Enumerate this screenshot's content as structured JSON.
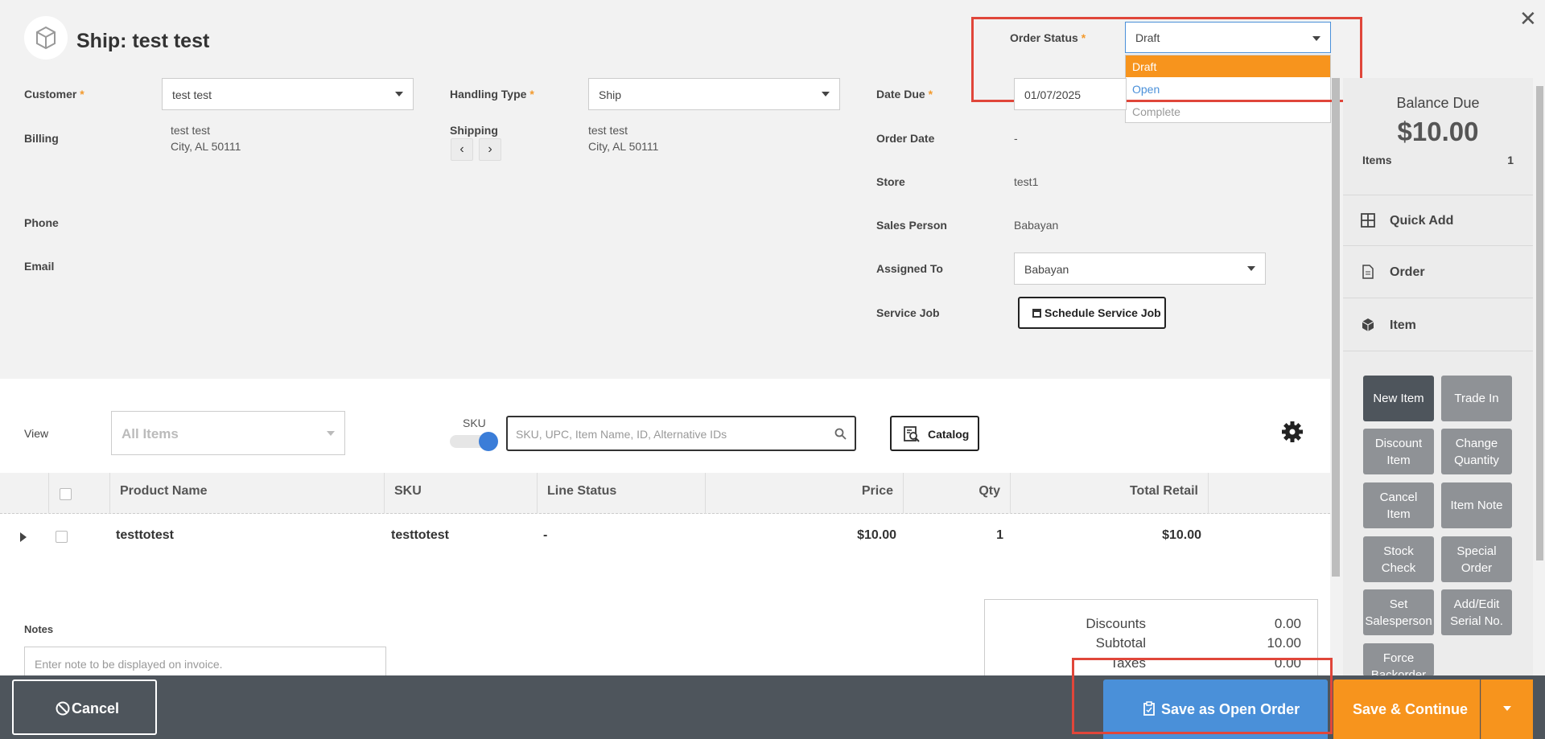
{
  "header": {
    "title": "Ship: test test",
    "close_label": "✕"
  },
  "order_status": {
    "label": "Order Status",
    "required": "*",
    "value": "Draft",
    "options": [
      "Draft",
      "Open",
      "Complete"
    ]
  },
  "customer": {
    "label": "Customer",
    "required": "*",
    "value": "test test"
  },
  "billing": {
    "label": "Billing",
    "line1": "test test",
    "line2": "City, AL 50111"
  },
  "phone": {
    "label": "Phone"
  },
  "email": {
    "label": "Email"
  },
  "handling": {
    "label": "Handling Type",
    "required": "*",
    "value": "Ship"
  },
  "shipping": {
    "label": "Shipping",
    "line1": "test test",
    "line2": "City, AL 50111",
    "prev": "‹",
    "next": "›"
  },
  "date_due": {
    "label": "Date Due",
    "required": "*",
    "value": "01/07/2025"
  },
  "order_date": {
    "label": "Order Date",
    "value": "-"
  },
  "store": {
    "label": "Store",
    "value": "test1"
  },
  "sales_person": {
    "label": "Sales Person",
    "value": "Babayan"
  },
  "assigned_to": {
    "label": "Assigned To",
    "value": "Babayan"
  },
  "service_job": {
    "label": "Service Job",
    "button": "Schedule Service Job"
  },
  "toolbar": {
    "view_label": "View",
    "view_value": "All Items",
    "sku_label": "SKU",
    "search_placeholder": "SKU, UPC, Item Name, ID, Alternative IDs",
    "catalog_label": "Catalog"
  },
  "table": {
    "columns": [
      "Product Name",
      "SKU",
      "Line Status",
      "Price",
      "Qty",
      "Total Retail"
    ],
    "rows": [
      {
        "product": "testtotest",
        "sku": "testtotest",
        "status": "-",
        "price": "$10.00",
        "qty": "1",
        "total": "$10.00"
      }
    ]
  },
  "notes": {
    "label": "Notes",
    "placeholder": "Enter note to be displayed on invoice."
  },
  "totals": {
    "discounts_label": "Discounts",
    "discounts": "0.00",
    "subtotal_label": "Subtotal",
    "subtotal": "10.00",
    "taxes_label": "Taxes",
    "taxes": "0.00"
  },
  "summary": {
    "balance_label": "Balance Due",
    "balance": "$10.00",
    "items_label": "Items",
    "items": "1"
  },
  "sidebar": {
    "quick_add": "Quick Add",
    "order": "Order",
    "item": "Item",
    "actions": [
      "New Item",
      "Trade In",
      "Discount Item",
      "Change Quantity",
      "Cancel Item",
      "Item Note",
      "Stock Check",
      "Special Order",
      "Set Salesperson",
      "Add/Edit Serial No.",
      "Force Backorder"
    ]
  },
  "footer": {
    "cancel": "Cancel",
    "save_open": "Save as Open Order",
    "save_continue": "Save & Continue"
  },
  "colors": {
    "accent_orange": "#f7941d",
    "accent_blue": "#4a90d9",
    "footer_bg": "#4e555c",
    "highlight_red": "#e0463a"
  }
}
